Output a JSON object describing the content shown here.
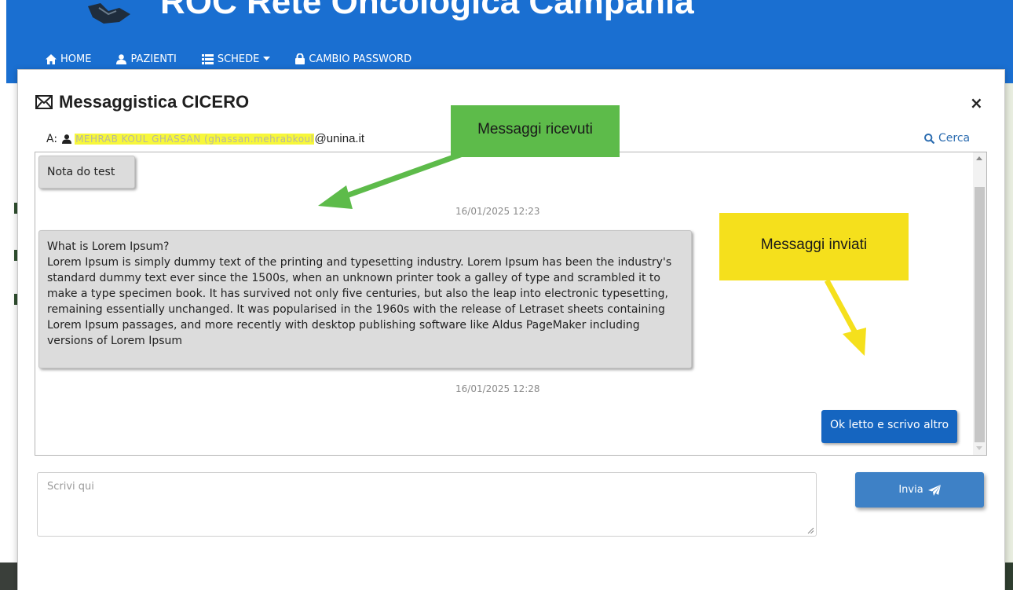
{
  "header": {
    "title": "ROC Rete Oncologica Campania",
    "nav": [
      {
        "label": "HOME",
        "icon": "home-icon"
      },
      {
        "label": "PAZIENTI",
        "icon": "user-icon"
      },
      {
        "label": "SCHEDE",
        "icon": "list-icon",
        "has_dropdown": true
      },
      {
        "label": "CAMBIO PASSWORD",
        "icon": "lock-icon"
      }
    ]
  },
  "modal": {
    "title": "Messaggistica CICERO",
    "title_icon": "envelope-icon",
    "close_label": "×",
    "to_label": "A:",
    "recipient_redacted": "MEHRAB KOUL GHASSAN (ghassan.mehrabkoul",
    "recipient_domain": "@unina.it",
    "search_label": "Cerca"
  },
  "messages": [
    {
      "direction": "received",
      "text": "Nota do test"
    },
    {
      "timestamp": "16/01/2025 12:23"
    },
    {
      "direction": "received",
      "text": "What is Lorem Ipsum?\nLorem Ipsum is simply dummy text of the printing and typesetting industry. Lorem Ipsum has been the industry's standard dummy text ever since the 1500s, when an unknown printer took a galley of type and scrambled it to make a type specimen book. It has survived not only five centuries, but also the leap into electronic typesetting, remaining essentially unchanged. It was popularised in the 1960s with the release of Letraset sheets containing Lorem Ipsum passages, and more recently with desktop publishing software like Aldus PageMaker including versions of Lorem Ipsum"
    },
    {
      "timestamp": "16/01/2025 12:28"
    },
    {
      "direction": "sent",
      "text": "Ok letto e scrivo altro"
    }
  ],
  "callouts": {
    "received": "Messaggi ricevuti",
    "sent": "Messaggi inviati"
  },
  "compose": {
    "placeholder": "Scrivi qui",
    "value": "",
    "send_label": "Invia"
  },
  "colors": {
    "header_blue": "#1a6fd1",
    "sent_bubble": "#1565c0",
    "received_bubble": "#dcdcdc",
    "send_button": "#3e81c6",
    "callout_green": "#5dbb4a",
    "callout_yellow": "#f5e01c",
    "link_blue": "#2b6cb0"
  }
}
